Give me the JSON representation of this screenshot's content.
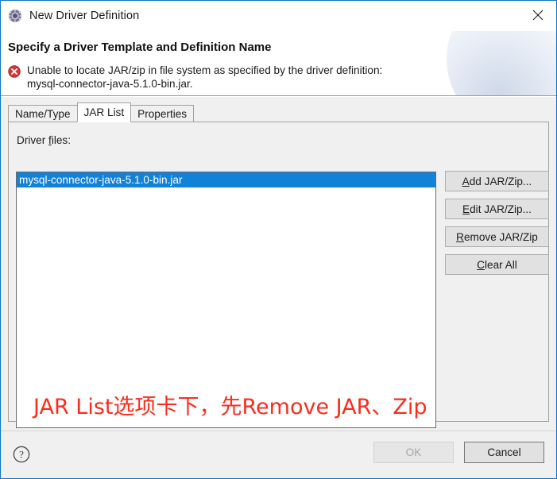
{
  "window": {
    "title": "New Driver Definition",
    "icon": "driver-gear-icon",
    "close_label": "✕",
    "border_color": "#0a76c4"
  },
  "header": {
    "title": "Specify a Driver Template and Definition Name",
    "status_icon": "error-icon",
    "message": "Unable to locate JAR/zip in file system as specified by the driver definition:\nmysql-connector-java-5.1.0-bin.jar.",
    "error_color": "#d83434"
  },
  "tabs": [
    {
      "label": "Name/Type",
      "active": false
    },
    {
      "label": "JAR List",
      "active": true
    },
    {
      "label": "Properties",
      "active": false
    }
  ],
  "jar_list_panel": {
    "driver_files_label_prefix": "Driver ",
    "driver_files_label_mnemonic": "f",
    "driver_files_label_suffix": "iles:",
    "items": [
      {
        "name": "mysql-connector-java-5.1.0-bin.jar",
        "selected": true
      }
    ],
    "selection_color": "#1281d8",
    "buttons": [
      {
        "mnemonic": "A",
        "rest": "dd JAR/Zip...",
        "enabled": true
      },
      {
        "mnemonic": "E",
        "rest": "dit JAR/Zip...",
        "enabled": true
      },
      {
        "mnemonic": "R",
        "rest": "emove JAR/Zip",
        "enabled": true
      },
      {
        "mnemonic": "C",
        "rest": "lear All",
        "enabled": true
      }
    ]
  },
  "annotation": {
    "text": "JAR List选项卡下，先Remove JAR、Zip",
    "color": "#fb2c1c"
  },
  "footer": {
    "help_label": "?",
    "ok_label": "OK",
    "ok_enabled": false,
    "cancel_label": "Cancel",
    "cancel_enabled": true
  }
}
